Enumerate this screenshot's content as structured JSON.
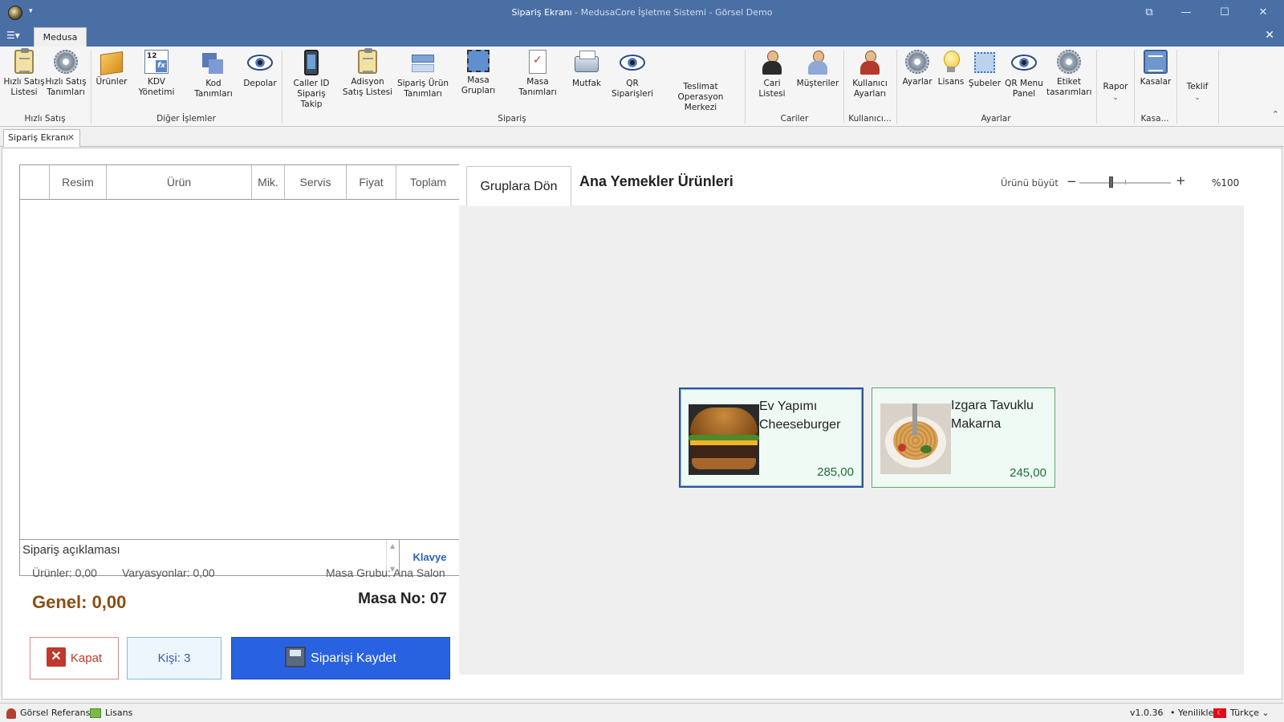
{
  "window": {
    "title_main": "Sipariş Ekranı",
    "title_rest": " - MedusaCore İşletme Sistemi - Görsel Demo"
  },
  "ribbon": {
    "tab": "Medusa",
    "buttons": {
      "hizli_satis_listesi": "Hızlı Satış Listesi",
      "hizli_satis_tanimlari": "Hızlı Satış Tanımları",
      "urunler": "Ürünler",
      "kdv_yonetimi": "KDV Yönetimi",
      "kod_tanimlari": "Kod Tanımları",
      "depolar": "Depolar",
      "caller_id": "Caller ID Sipariş Takip",
      "adisyon_satis": "Adisyon Satış Listesi",
      "siparis_urun_tanimlari": "Sipariş Ürün Tanımları",
      "masa_gruplari": "Masa Grupları",
      "masa_tanimlari": "Masa Tanımları",
      "mutfak": "Mutfak",
      "qr_siparisleri": "QR Siparişleri",
      "teslimat": "Teslimat Operasyon Merkezi",
      "cari_listesi": "Cari Listesi",
      "musteriler": "Müşteriler",
      "kullanici_ayarlari": "Kullanıcı Ayarları",
      "ayarlar": "Ayarlar",
      "lisans": "Lisans",
      "subeler": "Şubeler",
      "qr_menu_panel": "QR Menu Panel",
      "etiket": "Etiket tasarımları",
      "rapor": "Rapor",
      "kasalar": "Kasalar",
      "teklif": "Teklif"
    },
    "groups": {
      "hizli_satis": "Hızlı Satış",
      "diger": "Diğer İşlemler",
      "siparis": "Sipariş",
      "cariler": "Cariler",
      "kullanici": "Kullanıcı...",
      "ayarlar": "Ayarlar",
      "kasa": "Kasa..."
    },
    "kdv_icon_text": "12",
    "kdv_icon_fx": "fx"
  },
  "doc_tab": "Sipariş Ekranı",
  "order_grid": {
    "columns": [
      "Resim",
      "Ürün",
      "Mik.",
      "Servis",
      "Fiyat",
      "Toplam"
    ]
  },
  "note": {
    "text": "Sipariş açıklaması",
    "keyboard": "Klavye"
  },
  "summary": {
    "urunler": "Ürünler: 0,00",
    "varyasyonlar": "Varyasyonlar: 0,00",
    "masa_grubu": "Masa Grubu: Ana Salon",
    "genel": "Genel: 0,00",
    "masa_no": "Masa No: 07"
  },
  "actions": {
    "kapat": "Kapat",
    "kisi": "Kişi: 3",
    "kaydet": "Siparişi Kaydet"
  },
  "products_panel": {
    "back": "Gruplara Dön",
    "title": "Ana Yemekler Ürünleri",
    "zoom_label": "Ürünü büyüt",
    "zoom_value": "%100",
    "zoom_level": 0.35,
    "products": [
      {
        "name": "Ev Yapımı Cheeseburger",
        "price": "285,00",
        "selected": true
      },
      {
        "name": "Izgara Tavuklu Makarna",
        "price": "245,00",
        "selected": false
      }
    ]
  },
  "statusbar": {
    "referans": "Görsel Referans",
    "lisans": "Lisans",
    "version": "v1.0.36",
    "yenilikler": "Yenilikler",
    "language": "Türkçe"
  },
  "colors": {
    "titlebar": "#4a6fa5",
    "accent": "#2962e0",
    "total": "#8a4e12",
    "price": "#1f6f3c",
    "close_red": "#c0392b"
  }
}
